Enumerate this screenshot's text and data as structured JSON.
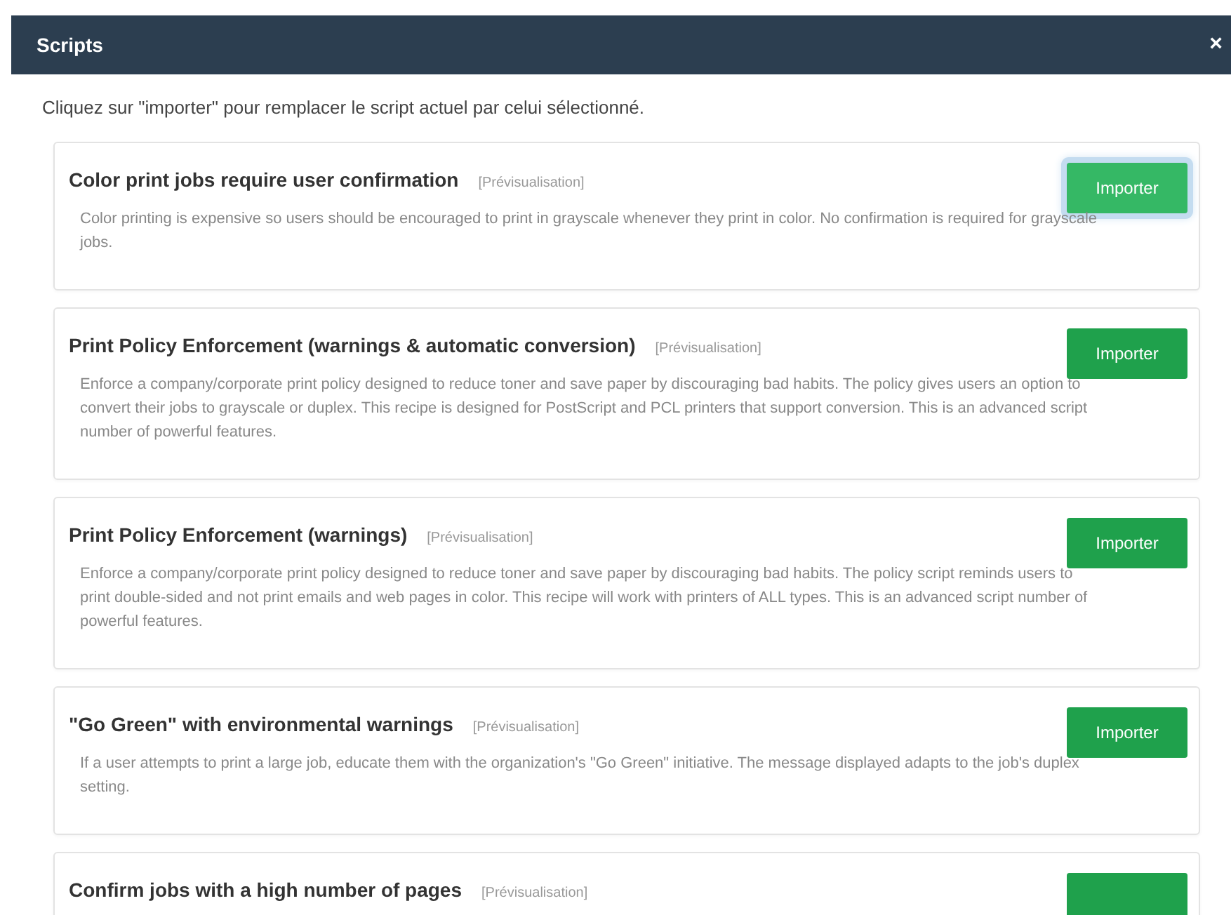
{
  "dialog": {
    "title": "Scripts",
    "close": "×",
    "intro": "Cliquez sur \"importer\" pour remplacer le script actuel par celui sélectionné."
  },
  "scripts": [
    {
      "title": "Color print jobs require user confirmation",
      "preview": "[Prévisualisation]",
      "button": "Importer",
      "focused": true,
      "description": "Color printing is expensive so users should be encouraged to print in grayscale whenever they print in color. No confirmation is required for grayscale jobs."
    },
    {
      "title": "Print Policy Enforcement (warnings & automatic conversion)",
      "preview": "[Prévisualisation]",
      "button": "Importer",
      "focused": false,
      "description": "Enforce a company/corporate print policy designed to reduce toner and save paper by discouraging bad habits. The policy gives users an option to convert their jobs to grayscale or duplex. This recipe is designed for PostScript and PCL printers that support conversion. This is an advanced script number of powerful features."
    },
    {
      "title": "Print Policy Enforcement (warnings)",
      "preview": "[Prévisualisation]",
      "button": "Importer",
      "focused": false,
      "description": "Enforce a company/corporate print policy designed to reduce toner and save paper by discouraging bad habits. The policy script reminds users to print double-sided and not print emails and web pages in color. This recipe will work with printers of ALL types. This is an advanced script number of powerful features."
    },
    {
      "title": "\"Go Green\" with environmental warnings",
      "preview": "[Prévisualisation]",
      "button": "Importer",
      "focused": false,
      "description": "If a user attempts to print a large job, educate them with the organization's \"Go Green\" initiative. The message displayed adapts to the job's duplex setting."
    },
    {
      "title": "Confirm jobs with a high number of pages",
      "preview": "[Prévisualisation]",
      "focused": false
    }
  ]
}
